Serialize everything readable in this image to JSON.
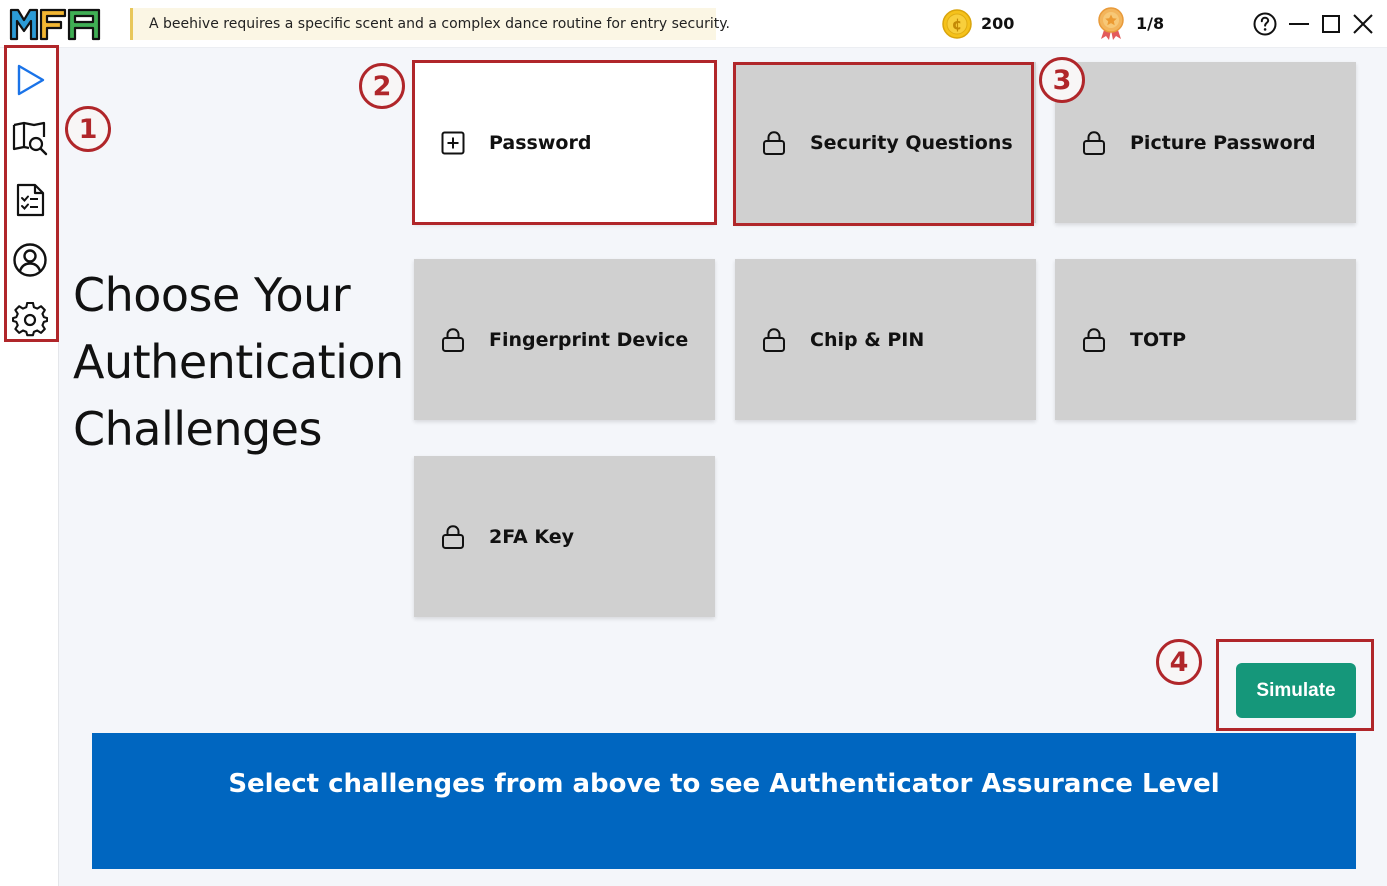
{
  "app": {
    "logo_text": "MFA",
    "tip_text": "A beehive requires a specific scent and a complex dance routine for entry security.",
    "coins": "200",
    "progress": "1/8",
    "icons": {
      "tip": "lightbulb-icon",
      "coins": "coin-icon",
      "progress": "medal-icon",
      "help": "help-icon",
      "minimize": "minimize-icon",
      "maximize": "maximize-icon",
      "close": "close-icon"
    }
  },
  "sidebar": {
    "items": [
      {
        "icon": "play-icon"
      },
      {
        "icon": "book-search-icon"
      },
      {
        "icon": "checklist-icon"
      },
      {
        "icon": "user-icon"
      },
      {
        "icon": "gear-icon"
      }
    ]
  },
  "main": {
    "heading": [
      "Choose Your",
      "Authentication",
      "Challenges"
    ],
    "cards": [
      {
        "label": "Password",
        "icon": "add-icon",
        "state": "selected"
      },
      {
        "label": "Security Questions",
        "icon": "lock-icon",
        "state": "locked"
      },
      {
        "label": "Picture Password",
        "icon": "lock-icon",
        "state": "locked"
      },
      {
        "label": "Fingerprint Device",
        "icon": "lock-icon",
        "state": "locked"
      },
      {
        "label": "Chip & PIN",
        "icon": "lock-icon",
        "state": "locked"
      },
      {
        "label": "TOTP",
        "icon": "lock-icon",
        "state": "locked"
      },
      {
        "label": "2FA Key",
        "icon": "lock-icon",
        "state": "locked"
      }
    ],
    "simulate_label": "Simulate",
    "banner_text": "Select challenges from above to see Authenticator Assurance Level"
  },
  "annotations": {
    "markers": [
      "1",
      "2",
      "3",
      "4"
    ]
  },
  "colors": {
    "accent_green": "#15977a",
    "banner_blue": "#0066c0",
    "annotation_red": "#b0262a",
    "locked_card": "#d0d0d0",
    "selected_card": "#ffffff"
  }
}
